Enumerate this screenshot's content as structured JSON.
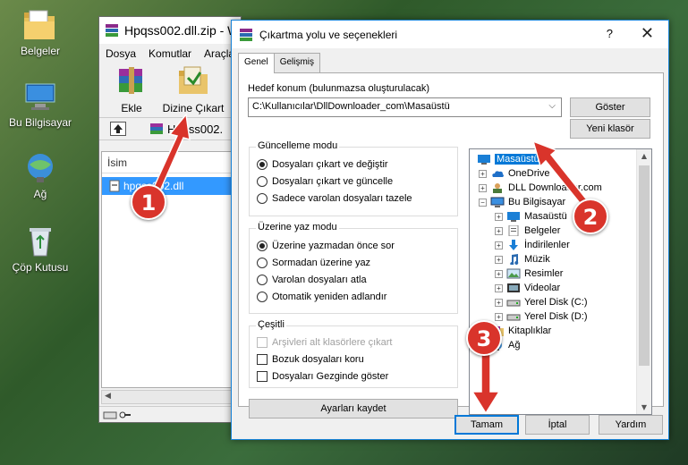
{
  "desktop": {
    "icons": [
      {
        "label": "Belgeler",
        "icon": "documents-folder-icon"
      },
      {
        "label": "Bu Bilgisayar",
        "icon": "computer-icon"
      },
      {
        "label": "Ağ",
        "icon": "network-icon"
      },
      {
        "label": "Çöp Kutusu",
        "icon": "recycle-bin-icon"
      }
    ]
  },
  "winrar": {
    "title": "Hpqss002.dll.zip - W",
    "menu": [
      "Dosya",
      "Komutlar",
      "Araçla"
    ],
    "toolbar": {
      "add_label": "Ekle",
      "extract_label": "Dizine Çıkart"
    },
    "path_text": "Hpqss002.",
    "column_name": "İsim",
    "file_name": "hpqss002.dll"
  },
  "dialog": {
    "title": "Çıkartma yolu ve seçenekleri",
    "help_symbol": "?",
    "close_symbol": "✕",
    "tabs": [
      "Genel",
      "Gelişmiş"
    ],
    "destination_label": "Hedef konum (bulunmazsa oluşturulacak)",
    "destination_value": "C:\\Kullanıcılar\\DllDownloader_com\\Masaüstü",
    "show_button": "Göster",
    "new_folder_button": "Yeni klasör",
    "update_mode": {
      "title": "Güncelleme modu",
      "options": [
        "Dosyaları çıkart ve değiştir",
        "Dosyaları çıkart ve güncelle",
        "Sadece varolan dosyaları tazele"
      ],
      "selected": 0
    },
    "overwrite_mode": {
      "title": "Üzerine yaz modu",
      "options": [
        "Üzerine yazmadan önce sor",
        "Sormadan üzerine yaz",
        "Varolan dosyaları atla",
        "Otomatik yeniden adlandır"
      ],
      "selected": 0
    },
    "misc": {
      "title": "Çeşitli",
      "options": [
        {
          "label": "Arşivleri alt klasörlere çıkart",
          "checked": false,
          "disabled": true
        },
        {
          "label": "Bozuk dosyaları koru",
          "checked": false,
          "disabled": false
        },
        {
          "label": "Dosyaları Gezginde göster",
          "checked": false,
          "disabled": false
        }
      ]
    },
    "save_settings_button": "Ayarları kaydet",
    "tree": [
      {
        "label": "Masaüstü",
        "level": 0,
        "selected": true,
        "expander": "",
        "icon": "desktop-icon"
      },
      {
        "label": "OneDrive",
        "level": 1,
        "selected": false,
        "expander": "+",
        "icon": "onedrive-icon"
      },
      {
        "label": "DLL Downloader.com",
        "level": 1,
        "selected": false,
        "expander": "+",
        "icon": "user-folder-icon"
      },
      {
        "label": "Bu Bilgisayar",
        "level": 1,
        "selected": false,
        "expander": "-",
        "icon": "computer-icon"
      },
      {
        "label": "Masaüstü",
        "level": 2,
        "selected": false,
        "expander": "+",
        "icon": "desktop-icon"
      },
      {
        "label": "Belgeler",
        "level": 2,
        "selected": false,
        "expander": "+",
        "icon": "documents-icon"
      },
      {
        "label": "İndirilenler",
        "level": 2,
        "selected": false,
        "expander": "+",
        "icon": "downloads-icon"
      },
      {
        "label": "Müzik",
        "level": 2,
        "selected": false,
        "expander": "+",
        "icon": "music-icon"
      },
      {
        "label": "Resimler",
        "level": 2,
        "selected": false,
        "expander": "+",
        "icon": "pictures-icon"
      },
      {
        "label": "Videolar",
        "level": 2,
        "selected": false,
        "expander": "+",
        "icon": "videos-icon"
      },
      {
        "label": "Yerel Disk (C:)",
        "level": 2,
        "selected": false,
        "expander": "+",
        "icon": "disk-drive-icon"
      },
      {
        "label": "Yerel Disk (D:)",
        "level": 2,
        "selected": false,
        "expander": "+",
        "icon": "disk-drive-icon"
      },
      {
        "label": "Kitaplıklar",
        "level": 1,
        "selected": false,
        "expander": "+",
        "icon": "libraries-icon"
      },
      {
        "label": "Ağ",
        "level": 1,
        "selected": false,
        "expander": "+",
        "icon": "network-icon"
      }
    ],
    "ok_button": "Tamam",
    "cancel_button": "İptal",
    "help_button": "Yardım"
  },
  "annotations": [
    "1",
    "2",
    "3"
  ],
  "colors": {
    "selection": "#0078d7",
    "annotation": "#d9342b",
    "dialog_border": "#1883d7"
  }
}
